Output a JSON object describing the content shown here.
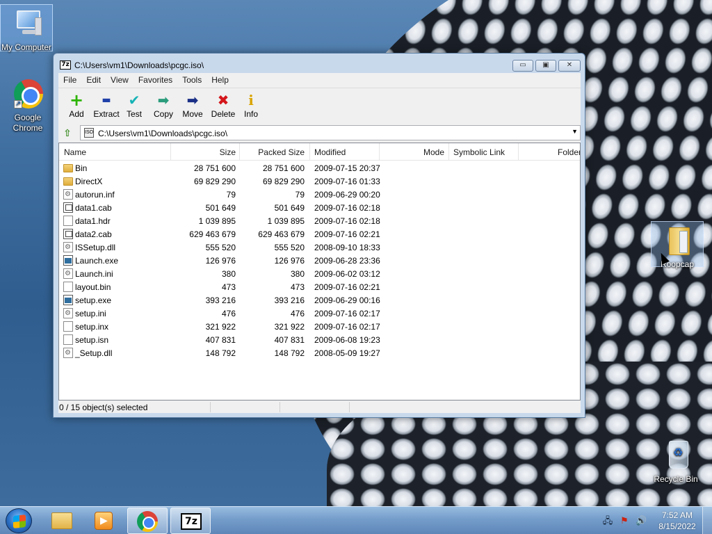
{
  "desktop": {
    "icons": [
      {
        "label": "My Computer"
      },
      {
        "label": "Google Chrome"
      },
      {
        "label": "Roopcap"
      },
      {
        "label": "Recycle Bin"
      }
    ]
  },
  "window": {
    "title": "C:\\Users\\vm1\\Downloads\\pcgc.iso\\",
    "title_icon": "7z",
    "controls": {
      "minimize": "▭",
      "maximize": "▣",
      "close": "✕"
    },
    "menu": [
      "File",
      "Edit",
      "View",
      "Favorites",
      "Tools",
      "Help"
    ],
    "toolbar": [
      {
        "label": "Add",
        "icon": "plus-icon",
        "glyph": "+",
        "color": "#2cb400"
      },
      {
        "label": "Extract",
        "icon": "minus-icon",
        "glyph": "▬",
        "color": "#1f3fa8"
      },
      {
        "label": "Test",
        "icon": "check-icon",
        "glyph": "✔",
        "color": "#16b3b6"
      },
      {
        "label": "Copy",
        "icon": "copy-arrow-icon",
        "glyph": "➡",
        "color": "#2a9c7c"
      },
      {
        "label": "Move",
        "icon": "move-arrow-icon",
        "glyph": "➡",
        "color": "#1a2f86"
      },
      {
        "label": "Delete",
        "icon": "delete-x-icon",
        "glyph": "✖",
        "color": "#d4161b"
      },
      {
        "label": "Info",
        "icon": "info-icon",
        "glyph": "i",
        "color": "#d9a400"
      }
    ],
    "address": {
      "path": "C:\\Users\\vm1\\Downloads\\pcgc.iso\\",
      "icon_label": "ISO"
    },
    "columns": [
      "Name",
      "Size",
      "Packed Size",
      "Modified",
      "Mode",
      "Symbolic Link",
      "Folder"
    ],
    "files": [
      {
        "name": "Bin",
        "size": "28 751 600",
        "packed": "28 751 600",
        "modified": "2009-07-15 20:37",
        "icon": "folder"
      },
      {
        "name": "DirectX",
        "size": "69 829 290",
        "packed": "69 829 290",
        "modified": "2009-07-16 01:33",
        "icon": "folder"
      },
      {
        "name": "autorun.inf",
        "size": "79",
        "packed": "79",
        "modified": "2009-06-29 00:20",
        "icon": "gear"
      },
      {
        "name": "data1.cab",
        "size": "501 649",
        "packed": "501 649",
        "modified": "2009-07-16 02:18",
        "icon": "cab"
      },
      {
        "name": "data1.hdr",
        "size": "1 039 895",
        "packed": "1 039 895",
        "modified": "2009-07-16 02:18",
        "icon": "file"
      },
      {
        "name": "data2.cab",
        "size": "629 463 679",
        "packed": "629 463 679",
        "modified": "2009-07-16 02:21",
        "icon": "cab"
      },
      {
        "name": "ISSetup.dll",
        "size": "555 520",
        "packed": "555 520",
        "modified": "2008-09-10 18:33",
        "icon": "gear"
      },
      {
        "name": "Launch.exe",
        "size": "126 976",
        "packed": "126 976",
        "modified": "2009-06-28 23:36",
        "icon": "exe"
      },
      {
        "name": "Launch.ini",
        "size": "380",
        "packed": "380",
        "modified": "2009-06-02 03:12",
        "icon": "gear"
      },
      {
        "name": "layout.bin",
        "size": "473",
        "packed": "473",
        "modified": "2009-07-16 02:21",
        "icon": "file"
      },
      {
        "name": "setup.exe",
        "size": "393 216",
        "packed": "393 216",
        "modified": "2009-06-29 00:16",
        "icon": "exe"
      },
      {
        "name": "setup.ini",
        "size": "476",
        "packed": "476",
        "modified": "2009-07-16 02:17",
        "icon": "gear"
      },
      {
        "name": "setup.inx",
        "size": "321 922",
        "packed": "321 922",
        "modified": "2009-07-16 02:17",
        "icon": "file"
      },
      {
        "name": "setup.isn",
        "size": "407 831",
        "packed": "407 831",
        "modified": "2009-06-08 19:23",
        "icon": "file"
      },
      {
        "name": "_Setup.dll",
        "size": "148 792",
        "packed": "148 792",
        "modified": "2008-05-09 19:27",
        "icon": "gear"
      }
    ],
    "status": "0 / 15 object(s) selected"
  },
  "taskbar": {
    "items": [
      "Windows Explorer",
      "Windows Media Player",
      "Google Chrome",
      "7-Zip"
    ],
    "task_7z_label": "7z",
    "clock": {
      "time": "7:52 AM",
      "date": "8/15/2022"
    }
  }
}
